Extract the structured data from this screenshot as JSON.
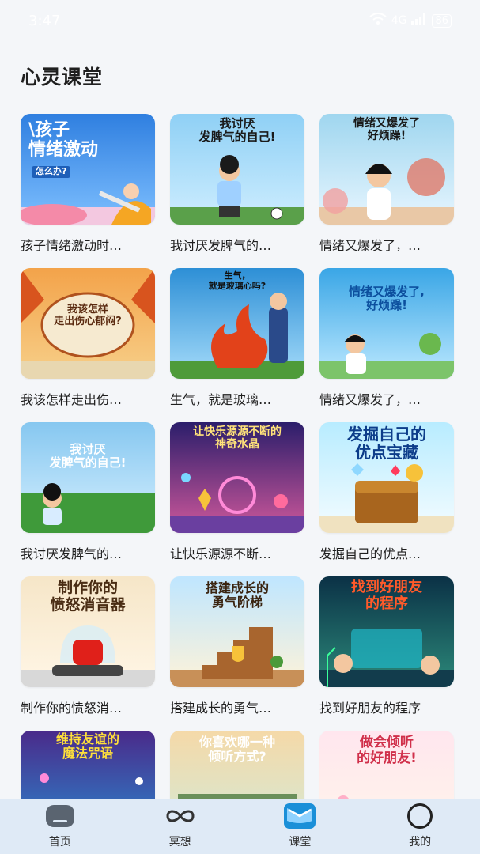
{
  "status_bar": {
    "time": "3:47",
    "network": "4G",
    "battery": "86"
  },
  "page_title": "心灵课堂",
  "colors": {
    "accent": "#1a8fd8",
    "tabbar_bg": "#dfeaf6",
    "page_bg": "#f4f6f9"
  },
  "cards": [
    {
      "title": "孩子情绪激动时…",
      "thumb_text": "\\孩子\n情绪激动",
      "thumb_sub": "怎么办?",
      "icon": "upset-child-illustration"
    },
    {
      "title": "我讨厌发脾气的…",
      "thumb_text": "我讨厌\n发脾气的自己!",
      "icon": "boy-soccer-illustration"
    },
    {
      "title": "情绪又爆发了，…",
      "thumb_text": "情绪又爆发了\n好烦躁!",
      "icon": "girl-monsters-illustration"
    },
    {
      "title": "我该怎样走出伤…",
      "thumb_text": "我该怎样\n走出伤心郁闷?",
      "icon": "autumn-leaves-illustration"
    },
    {
      "title": "生气，就是玻璃…",
      "thumb_text": "生气，\n就是玻璃心吗?",
      "icon": "fire-flower-illustration"
    },
    {
      "title": "情绪又爆发了，…",
      "thumb_text": "情绪又爆发了,\n好烦躁!",
      "icon": "girl-garden-illustration"
    },
    {
      "title": "我讨厌发脾气的…",
      "thumb_text": "我讨厌\n发脾气的自己!",
      "icon": "boy-field-illustration"
    },
    {
      "title": "让快乐源源不断…",
      "thumb_text": "让快乐源源不断的\n神奇水晶",
      "icon": "crystal-magic-illustration"
    },
    {
      "title": "发掘自己的优点…",
      "thumb_text": "发掘自己的\n优点宝藏",
      "icon": "treasure-chest-illustration"
    },
    {
      "title": "制作你的愤怒消…",
      "thumb_text": "制作你的\n愤怒消音器",
      "icon": "red-siren-illustration"
    },
    {
      "title": "搭建成长的勇气…",
      "thumb_text": "搭建成长的\n勇气阶梯",
      "icon": "stairs-shield-illustration"
    },
    {
      "title": "找到好朋友的程序",
      "thumb_text": "找到好朋友\n的程序",
      "icon": "kids-computer-illustration"
    },
    {
      "title": "",
      "thumb_text": "维持友谊的\n魔法咒语",
      "icon": "friends-magic-illustration"
    },
    {
      "title": "",
      "thumb_text": "你喜欢哪一种\n倾听方式?",
      "icon": "listening-illustration"
    },
    {
      "title": "",
      "thumb_text": "做会倾听\n的好朋友!",
      "icon": "good-listener-illustration"
    }
  ],
  "tabs": [
    {
      "label": "首页",
      "icon": "home-icon",
      "active": false
    },
    {
      "label": "冥想",
      "icon": "infinity-icon",
      "active": false
    },
    {
      "label": "课堂",
      "icon": "classroom-icon",
      "active": true
    },
    {
      "label": "我的",
      "icon": "profile-icon",
      "active": false
    }
  ]
}
